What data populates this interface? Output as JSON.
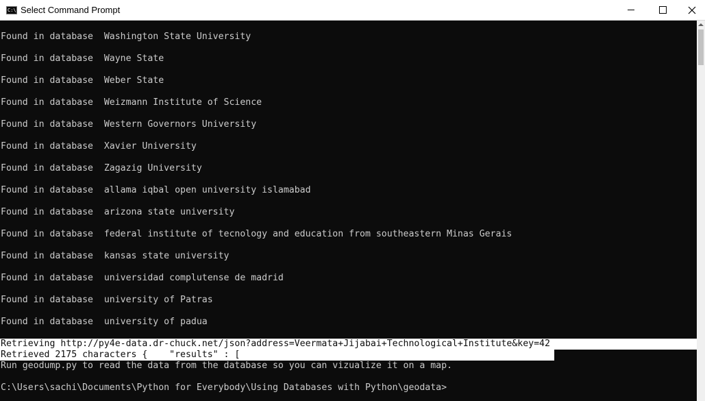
{
  "window": {
    "title": "Select Command Prompt",
    "icon": "cmd-icon",
    "icon_text": "C:\\",
    "controls": {
      "minimize": "minimize-icon",
      "maximize": "maximize-icon",
      "close": "close-icon"
    }
  },
  "console": {
    "background": "#0c0c0c",
    "foreground": "#cccccc",
    "selection_background": "#ffffff",
    "lines": [
      "Found in database  Washington State University",
      "Found in database  Wayne State",
      "Found in database  Weber State",
      "Found in database  Weizmann Institute of Science",
      "Found in database  Western Governors University",
      "Found in database  Xavier University",
      "Found in database  Zagazig University",
      "Found in database  allama iqbal open university islamabad",
      "Found in database  arizona state university",
      "Found in database  federal institute of tecnology and education from southeastern Minas Gerais",
      "Found in database  kansas state university",
      "Found in database  universidad complutense de madrid",
      "Found in database  university of Patras",
      "Found in database  university of padua",
      "Retrieving http://py4e-data.dr-chuck.net/json?address=Veermata+Jijabai+Technological+Institute&key=42",
      "Retrieved 2175 characters {    \"results\" : [",
      "Run geodump.py to read the data from the database so you can vizualize it on a map.",
      "C:\\Users\\sachi\\Documents\\Python for Everybody\\Using Databases with Python\\geodata>"
    ]
  }
}
